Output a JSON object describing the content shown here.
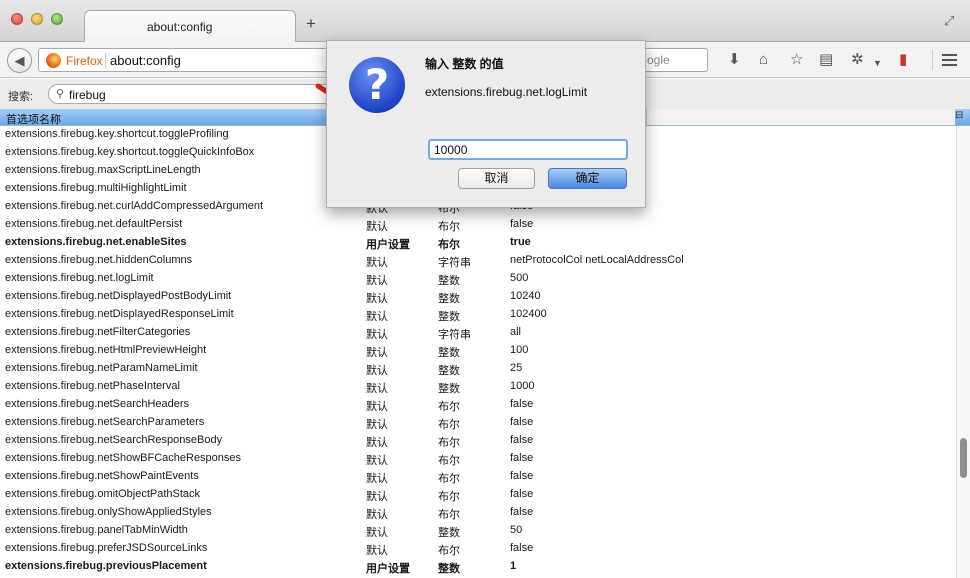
{
  "window": {
    "tab_title": "about:config",
    "new_tab_glyph": "+"
  },
  "navbar": {
    "identity_label": "Firefox",
    "url": "about:config",
    "search_partial": "ogle",
    "icons": [
      "download-icon",
      "home-icon",
      "bookmark-star-icon",
      "reading-list-icon",
      "firebug-icon",
      "addon-icon",
      "menu-icon"
    ]
  },
  "filter": {
    "label": "搜索:",
    "value": "firebug"
  },
  "table": {
    "header_name": "首选项名称",
    "column_picker_glyph": "⊟",
    "rows": [
      {
        "name": "extensions.firebug.key.shortcut.toggleProfiling",
        "status": "",
        "type": "",
        "value": "",
        "bold": false
      },
      {
        "name": "extensions.firebug.key.shortcut.toggleQuickInfoBox",
        "status": "",
        "type": "",
        "value": "",
        "bold": false
      },
      {
        "name": "extensions.firebug.maxScriptLineLength",
        "status": "",
        "type": "",
        "value": "",
        "bold": false
      },
      {
        "name": "extensions.firebug.multiHighlightLimit",
        "status": "",
        "type": "",
        "value": "",
        "bold": false
      },
      {
        "name": "extensions.firebug.net.curlAddCompressedArgument",
        "status": "默认",
        "type": "布尔",
        "value": "false",
        "bold": false
      },
      {
        "name": "extensions.firebug.net.defaultPersist",
        "status": "默认",
        "type": "布尔",
        "value": "false",
        "bold": false
      },
      {
        "name": "extensions.firebug.net.enableSites",
        "status": "用户设置",
        "type": "布尔",
        "value": "true",
        "bold": true
      },
      {
        "name": "extensions.firebug.net.hiddenColumns",
        "status": "默认",
        "type": "字符串",
        "value": "netProtocolCol netLocalAddressCol",
        "bold": false
      },
      {
        "name": "extensions.firebug.net.logLimit",
        "status": "默认",
        "type": "整数",
        "value": "500",
        "bold": false
      },
      {
        "name": "extensions.firebug.netDisplayedPostBodyLimit",
        "status": "默认",
        "type": "整数",
        "value": "10240",
        "bold": false
      },
      {
        "name": "extensions.firebug.netDisplayedResponseLimit",
        "status": "默认",
        "type": "整数",
        "value": "102400",
        "bold": false
      },
      {
        "name": "extensions.firebug.netFilterCategories",
        "status": "默认",
        "type": "字符串",
        "value": "all",
        "bold": false
      },
      {
        "name": "extensions.firebug.netHtmlPreviewHeight",
        "status": "默认",
        "type": "整数",
        "value": "100",
        "bold": false
      },
      {
        "name": "extensions.firebug.netParamNameLimit",
        "status": "默认",
        "type": "整数",
        "value": "25",
        "bold": false
      },
      {
        "name": "extensions.firebug.netPhaseInterval",
        "status": "默认",
        "type": "整数",
        "value": "1000",
        "bold": false
      },
      {
        "name": "extensions.firebug.netSearchHeaders",
        "status": "默认",
        "type": "布尔",
        "value": "false",
        "bold": false
      },
      {
        "name": "extensions.firebug.netSearchParameters",
        "status": "默认",
        "type": "布尔",
        "value": "false",
        "bold": false
      },
      {
        "name": "extensions.firebug.netSearchResponseBody",
        "status": "默认",
        "type": "布尔",
        "value": "false",
        "bold": false
      },
      {
        "name": "extensions.firebug.netShowBFCacheResponses",
        "status": "默认",
        "type": "布尔",
        "value": "false",
        "bold": false
      },
      {
        "name": "extensions.firebug.netShowPaintEvents",
        "status": "默认",
        "type": "布尔",
        "value": "false",
        "bold": false
      },
      {
        "name": "extensions.firebug.omitObjectPathStack",
        "status": "默认",
        "type": "布尔",
        "value": "false",
        "bold": false
      },
      {
        "name": "extensions.firebug.onlyShowAppliedStyles",
        "status": "默认",
        "type": "布尔",
        "value": "false",
        "bold": false
      },
      {
        "name": "extensions.firebug.panelTabMinWidth",
        "status": "默认",
        "type": "整数",
        "value": "50",
        "bold": false
      },
      {
        "name": "extensions.firebug.preferJSDSourceLinks",
        "status": "默认",
        "type": "布尔",
        "value": "false",
        "bold": false
      },
      {
        "name": "extensions.firebug.previousPlacement",
        "status": "用户设置",
        "type": "整数",
        "value": "1",
        "bold": true
      }
    ]
  },
  "dialog": {
    "title": "输入 整数 的值",
    "message": "extensions.firebug.net.logLimit",
    "input_value": "10000",
    "cancel_label": "取消",
    "ok_label": "确定",
    "icon_glyph": "?"
  },
  "colors": {
    "header_blue": "#6aa9ea",
    "arrow_red": "#e0261c",
    "firefox_orange": "#e66000"
  }
}
